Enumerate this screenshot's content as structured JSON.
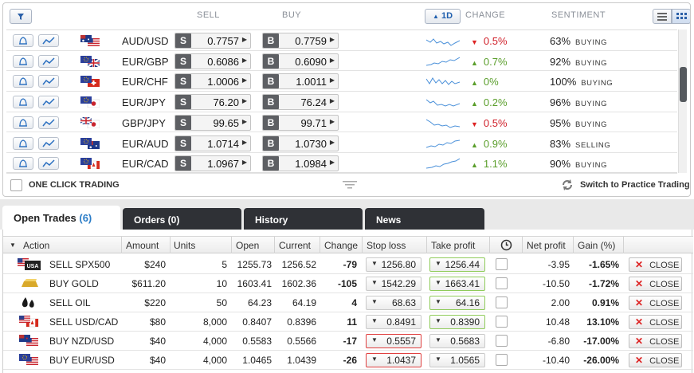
{
  "top_panel": {
    "headers": {
      "sell": "SELL",
      "buy": "BUY",
      "period": "1D",
      "change": "CHANGE",
      "sentiment": "SENTIMENT"
    },
    "rates": [
      {
        "pair": "AUD/USD",
        "flag": "australia-usa-flag-icon",
        "sell": "0.7757",
        "buy": "0.7759",
        "dir": "down",
        "change": "0.5%",
        "pct": "63%",
        "sentiment": "BUYING"
      },
      {
        "pair": "EUR/GBP",
        "flag": "eu-uk-flag-icon",
        "sell": "0.6086",
        "buy": "0.6090",
        "dir": "up",
        "change": "0.7%",
        "pct": "92%",
        "sentiment": "BUYING"
      },
      {
        "pair": "EUR/CHF",
        "flag": "eu-switzerland-flag-icon",
        "sell": "1.0006",
        "buy": "1.0011",
        "dir": "up",
        "change": "0%",
        "pct": "100%",
        "sentiment": "BUYING"
      },
      {
        "pair": "EUR/JPY",
        "flag": "eu-japan-flag-icon",
        "sell": "76.20",
        "buy": "76.24",
        "dir": "up",
        "change": "0.2%",
        "pct": "96%",
        "sentiment": "BUYING"
      },
      {
        "pair": "GBP/JPY",
        "flag": "uk-japan-flag-icon",
        "sell": "99.65",
        "buy": "99.71",
        "dir": "down",
        "change": "0.5%",
        "pct": "95%",
        "sentiment": "BUYING"
      },
      {
        "pair": "EUR/AUD",
        "flag": "eu-australia-flag-icon",
        "sell": "1.0714",
        "buy": "1.0730",
        "dir": "up",
        "change": "0.9%",
        "pct": "83%",
        "sentiment": "SELLING"
      },
      {
        "pair": "EUR/CAD",
        "flag": "eu-canada-flag-icon",
        "sell": "1.0967",
        "buy": "1.0984",
        "dir": "up",
        "change": "1.1%",
        "pct": "90%",
        "sentiment": "BUYING"
      }
    ],
    "sell_letter": "S",
    "buy_letter": "B",
    "one_click_label": "ONE CLICK TRADING",
    "practice_label": "Switch to Practice Trading"
  },
  "tabs": [
    {
      "label": "Open Trades",
      "count": "(6)"
    },
    {
      "label": "Orders (0)"
    },
    {
      "label": "History"
    },
    {
      "label": "News"
    }
  ],
  "trades": {
    "columns": [
      "Action",
      "Amount",
      "Units",
      "Open",
      "Current",
      "Change",
      "Stop loss",
      "Take profit",
      "Net profit",
      "Gain (%)"
    ],
    "rows": [
      {
        "icon": "usa-spx-flag-icon",
        "action": "SELL SPX500",
        "amount": "$240",
        "units": "5",
        "open": "1255.73",
        "current": "1256.52",
        "change": "-79",
        "change_dir": "dn",
        "stop": "1256.80",
        "stop_style": "normal",
        "take": "1256.44",
        "take_style": "green",
        "net": "-3.95",
        "gain": "-1.65%",
        "gain_dir": "dn"
      },
      {
        "icon": "gold-bar-icon",
        "action": "BUY GOLD",
        "amount": "$611.20",
        "units": "10",
        "open": "1603.41",
        "current": "1602.36",
        "change": "-105",
        "change_dir": "dn",
        "stop": "1542.29",
        "stop_style": "normal",
        "take": "1663.41",
        "take_style": "green",
        "net": "-10.50",
        "gain": "-1.72%",
        "gain_dir": "dn"
      },
      {
        "icon": "oil-drops-icon",
        "action": "SELL OIL",
        "amount": "$220",
        "units": "50",
        "open": "64.23",
        "current": "64.19",
        "change": "4",
        "change_dir": "up",
        "stop": "68.63",
        "stop_style": "normal",
        "take": "64.16",
        "take_style": "green",
        "net": "2.00",
        "gain": "0.91%",
        "gain_dir": "up"
      },
      {
        "icon": "usa-canada-flag-icon",
        "action": "SELL USD/CAD",
        "amount": "$80",
        "units": "8,000",
        "open": "0.8407",
        "current": "0.8396",
        "change": "11",
        "change_dir": "up",
        "stop": "0.8491",
        "stop_style": "normal",
        "take": "0.8390",
        "take_style": "green",
        "net": "10.48",
        "gain": "13.10%",
        "gain_dir": "up"
      },
      {
        "icon": "nz-usa-flag-icon",
        "action": "BUY NZD/USD",
        "amount": "$40",
        "units": "4,000",
        "open": "0.5583",
        "current": "0.5566",
        "change": "-17",
        "change_dir": "dn",
        "stop": "0.5557",
        "stop_style": "red",
        "take": "0.5683",
        "take_style": "normal",
        "net": "-6.80",
        "gain": "-17.00%",
        "gain_dir": "dn"
      },
      {
        "icon": "eu-usa-flag-icon",
        "action": "BUY EUR/USD",
        "amount": "$40",
        "units": "4,000",
        "open": "1.0465",
        "current": "1.0439",
        "change": "-26",
        "change_dir": "dn",
        "stop": "1.0437",
        "stop_style": "red",
        "take": "1.0565",
        "take_style": "normal",
        "net": "-10.40",
        "gain": "-26.00%",
        "gain_dir": "dn"
      }
    ],
    "close_label": "CLOSE"
  }
}
